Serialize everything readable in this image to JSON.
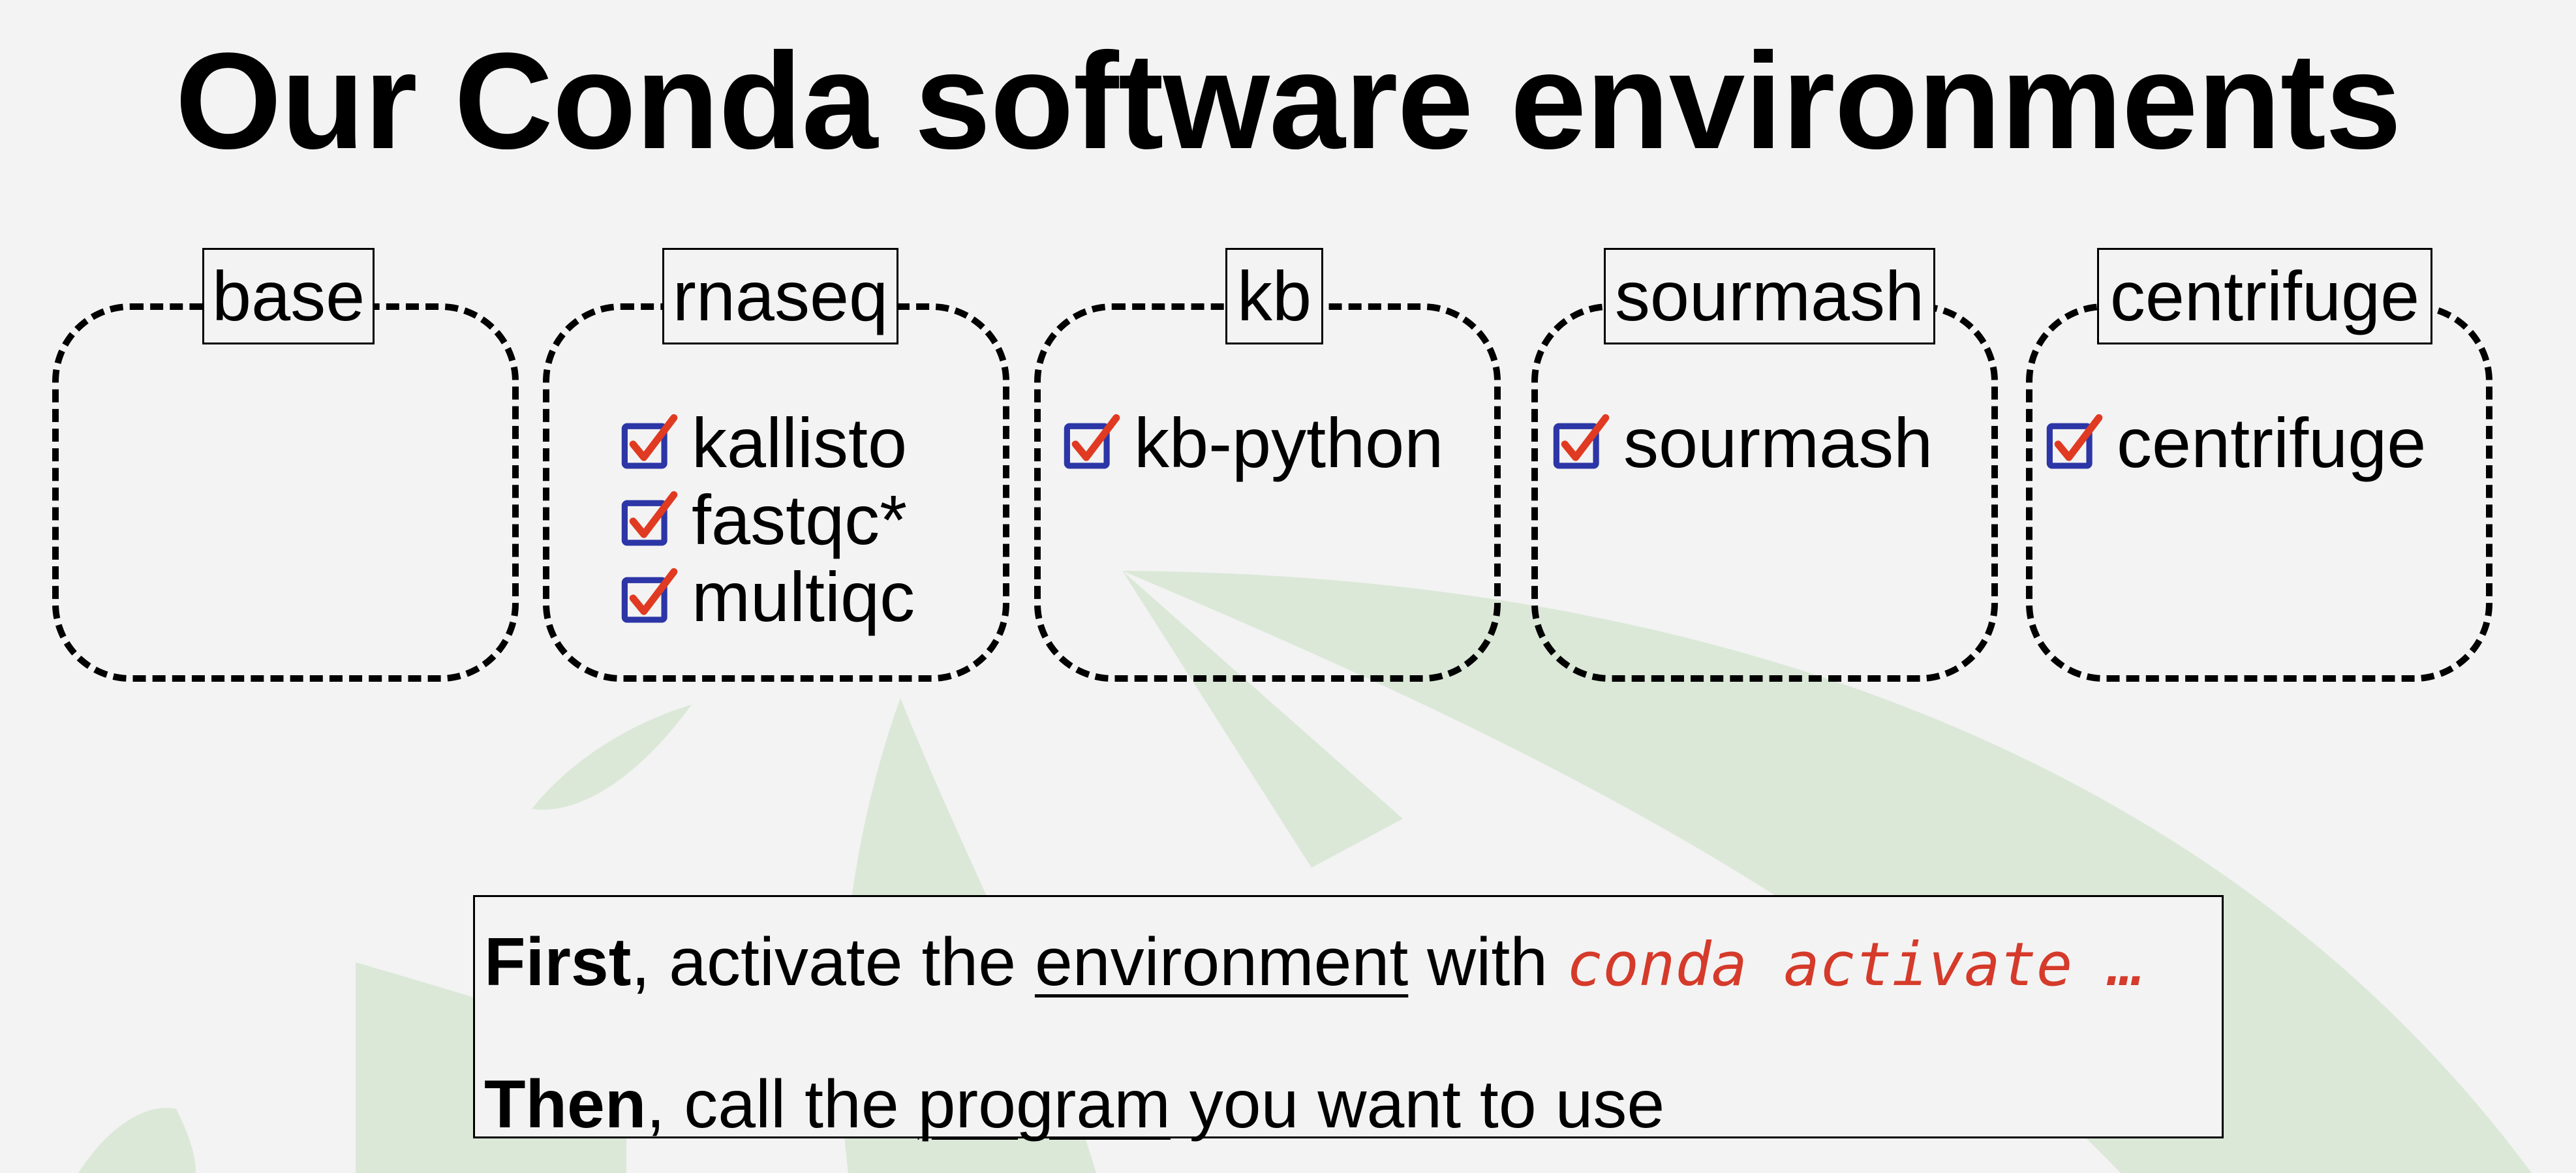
{
  "title": "Our Conda software environments",
  "environments": [
    {
      "name": "base",
      "packages": []
    },
    {
      "name": "rnaseq",
      "packages": [
        "kallisto",
        "fastqc*",
        "multiqc"
      ]
    },
    {
      "name": "kb",
      "packages": [
        "kb-python"
      ]
    },
    {
      "name": "sourmash",
      "packages": [
        "sourmash"
      ]
    },
    {
      "name": "centrifuge",
      "packages": [
        "centrifuge"
      ]
    }
  ],
  "instructions": {
    "line1": {
      "bold": "First",
      "text1": ", activate the ",
      "underlined": "environment",
      "text2": " with ",
      "code": "conda activate …"
    },
    "line2": {
      "bold": "Then",
      "text1": ", call the ",
      "underlined": "program",
      "text2": " you want to use"
    }
  },
  "colors": {
    "background": "#f3f3f3",
    "watermark": "#dbe8d8",
    "checkbox_border": "#2c36a6",
    "checkmark": "#e03a22",
    "code": "#d53a2a"
  }
}
